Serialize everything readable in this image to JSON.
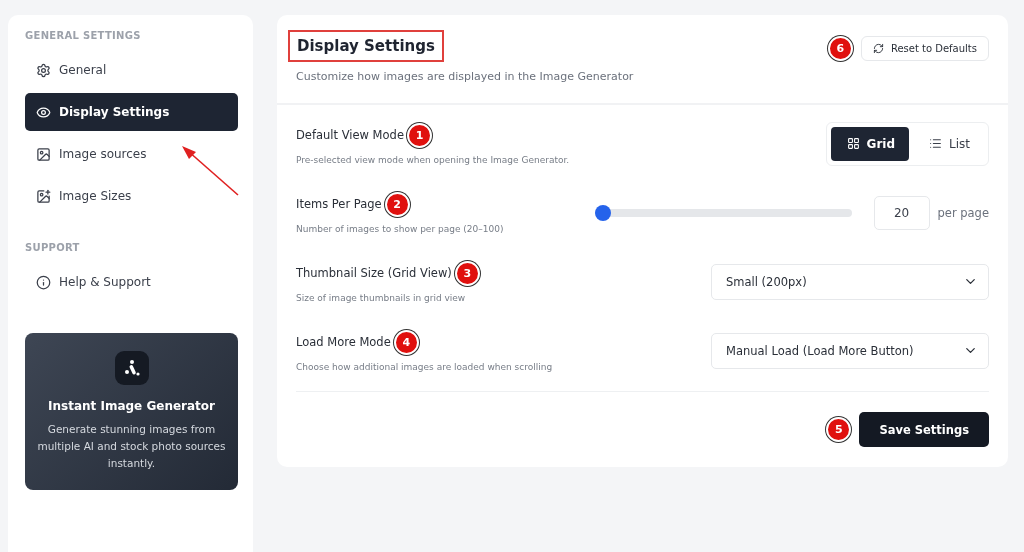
{
  "sidebar": {
    "sections": [
      {
        "heading": "GENERAL SETTINGS",
        "items": [
          {
            "label": "General",
            "selected": false
          },
          {
            "label": "Display Settings",
            "selected": true
          },
          {
            "label": "Image sources",
            "selected": false
          },
          {
            "label": "Image Sizes",
            "selected": false
          }
        ]
      },
      {
        "heading": "SUPPORT",
        "items": [
          {
            "label": "Help & Support",
            "selected": false
          }
        ]
      }
    ],
    "pointer_arrow": true,
    "promo": {
      "title": "Instant Image Generator",
      "text": "Generate stunning images from multiple AI and stock photo sources instantly."
    }
  },
  "panel": {
    "title": "Display Settings",
    "title_highlighted": true,
    "subtitle": "Customize how images are displayed in the Image Generator",
    "reset_button": {
      "label": "Reset to Defaults",
      "callout": "6"
    },
    "settings": [
      {
        "kind": "toggle",
        "label": "Default View Mode",
        "callout": "1",
        "description": "Pre-selected view mode when opening the Image Generator.",
        "options": [
          {
            "label": "Grid",
            "selected": true
          },
          {
            "label": "List",
            "selected": false
          }
        ]
      },
      {
        "kind": "slider",
        "label": "Items Per Page",
        "callout": "2",
        "description": "Number of images to show per page (20–100)",
        "level": 0,
        "value": "20",
        "unit": "per page"
      },
      {
        "kind": "select",
        "label": "Thumbnail Size (Grid View)",
        "callout": "3",
        "description": "Size of image thumbnails in grid view",
        "value": "Small (200px)"
      },
      {
        "kind": "select",
        "label": "Load More Mode",
        "callout": "4",
        "description": "Choose how additional images are loaded when scrolling",
        "value": "Manual Load (Load More Button)"
      }
    ],
    "save_button": {
      "label": "Save Settings",
      "callout": "5"
    }
  }
}
